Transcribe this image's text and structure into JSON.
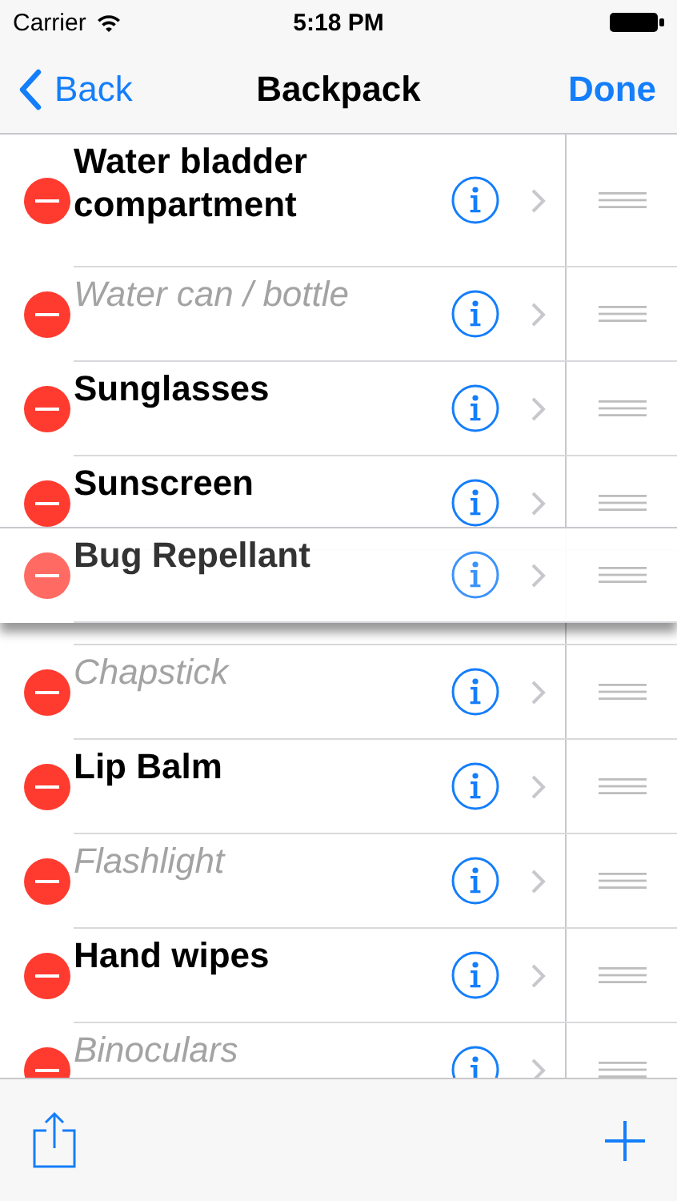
{
  "status_bar": {
    "carrier": "Carrier",
    "time": "5:18 PM"
  },
  "nav_bar": {
    "back": "Back",
    "title": "Backpack",
    "done": "Done"
  },
  "items": [
    {
      "label": "Water bladder compartment",
      "packed": false,
      "dragging": false
    },
    {
      "label": "Water can / bottle",
      "packed": true,
      "dragging": false
    },
    {
      "label": "Sunglasses",
      "packed": false,
      "dragging": false
    },
    {
      "label": "Sunscreen",
      "packed": false,
      "dragging": false
    },
    {
      "label": "Bug Repellant",
      "packed": false,
      "dragging": true
    },
    {
      "label": "Chapstick",
      "packed": true,
      "dragging": false
    },
    {
      "label": "Lip Balm",
      "packed": false,
      "dragging": false
    },
    {
      "label": "Flashlight",
      "packed": true,
      "dragging": false
    },
    {
      "label": "Hand wipes",
      "packed": false,
      "dragging": false
    },
    {
      "label": "Binoculars",
      "packed": true,
      "dragging": false
    }
  ]
}
